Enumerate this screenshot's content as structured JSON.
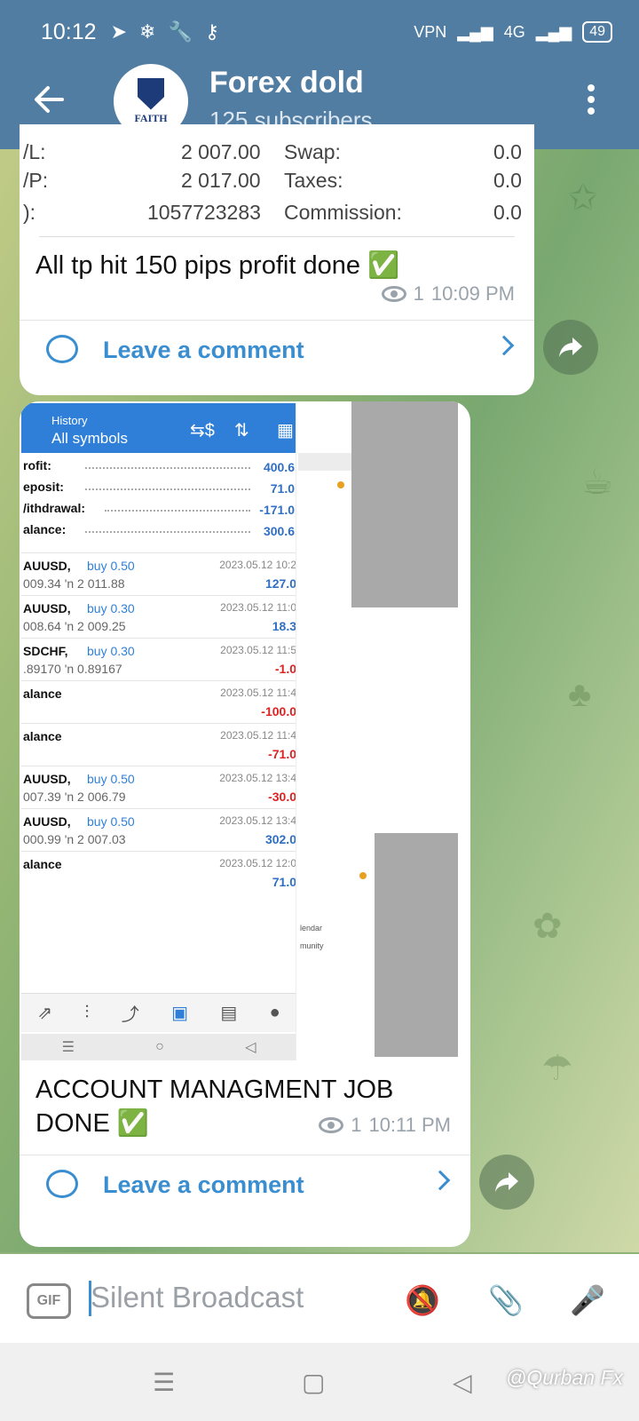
{
  "status_bar": {
    "time": "10:12",
    "vpn": "VPN",
    "network": "4G",
    "battery": "49"
  },
  "header": {
    "title": "Forex dold",
    "subtitle": "125 subscribers",
    "avatar_text": "FAITH"
  },
  "message1": {
    "table": [
      {
        "label": "/L:",
        "value": "2 007.00",
        "label2": "Swap:",
        "value2": "0.0"
      },
      {
        "label": "/P:",
        "value": "2 017.00",
        "label2": "Taxes:",
        "value2": "0.0"
      },
      {
        "label": "):",
        "value": "1057723283",
        "label2": "Commission:",
        "value2": "0.0"
      }
    ],
    "text": "All tp hit 150 pips profit done ✅",
    "views": "1",
    "time": "10:09 PM",
    "comment_label": "Leave a comment"
  },
  "message2": {
    "screenshot": {
      "header_small": "History",
      "header_big": "All symbols",
      "summary": [
        {
          "label": "rofit:",
          "value": "400.6"
        },
        {
          "label": "eposit:",
          "value": "71.0"
        },
        {
          "label": "/ithdrawal:",
          "value": "-171.0"
        },
        {
          "label": "alance:",
          "value": "300.6"
        }
      ],
      "trades": [
        {
          "sym": "AUUSD,",
          "side": "buy 0.50",
          "px": "009.34 'n  2 011.88",
          "dt": "2023.05.12 10:2",
          "pl": "127.0",
          "sign": "pos"
        },
        {
          "sym": "AUUSD,",
          "side": "buy 0.30",
          "px": "008.64 'n  2 009.25",
          "dt": "2023.05.12 11:0",
          "pl": "18.3",
          "sign": "pos"
        },
        {
          "sym": "SDCHF,",
          "side": "buy 0.30",
          "px": ".89170 'n  0.89167",
          "dt": "2023.05.12 11:5",
          "pl": "-1.0",
          "sign": "neg"
        },
        {
          "sym": "alance",
          "side": "",
          "px": "",
          "dt": "2023.05.12 11:4",
          "pl": "-100.0",
          "sign": "neg"
        },
        {
          "sym": "alance",
          "side": "",
          "px": "",
          "dt": "2023.05.12 11:4",
          "pl": "-71.0",
          "sign": "neg"
        },
        {
          "sym": "AUUSD,",
          "side": "buy 0.50",
          "px": "007.39 'n  2 006.79",
          "dt": "2023.05.12 13:4",
          "pl": "-30.0",
          "sign": "neg"
        },
        {
          "sym": "AUUSD,",
          "side": "buy 0.50",
          "px": "000.99 'n  2 007.03",
          "dt": "2023.05.12 13:4",
          "pl": "302.0",
          "sign": "pos"
        },
        {
          "sym": "alance",
          "side": "",
          "px": "",
          "dt": "2023.05.12 12:0",
          "pl": "71.0",
          "sign": "pos"
        }
      ],
      "side_texts": [
        "lendar",
        "munity"
      ]
    },
    "text_line1": "ACCOUNT MANAGMENT JOB",
    "text_line2": "DONE ✅",
    "views": "1",
    "time": "10:11 PM",
    "comment_label": "Leave a comment"
  },
  "input": {
    "placeholder": "Silent Broadcast",
    "gif_label": "GIF"
  },
  "watermark": "@Qurban Fx",
  "colors": {
    "header": "#517da2",
    "accent": "#3a8ed0",
    "positive": "#2f6fc4",
    "negative": "#dd2222"
  }
}
